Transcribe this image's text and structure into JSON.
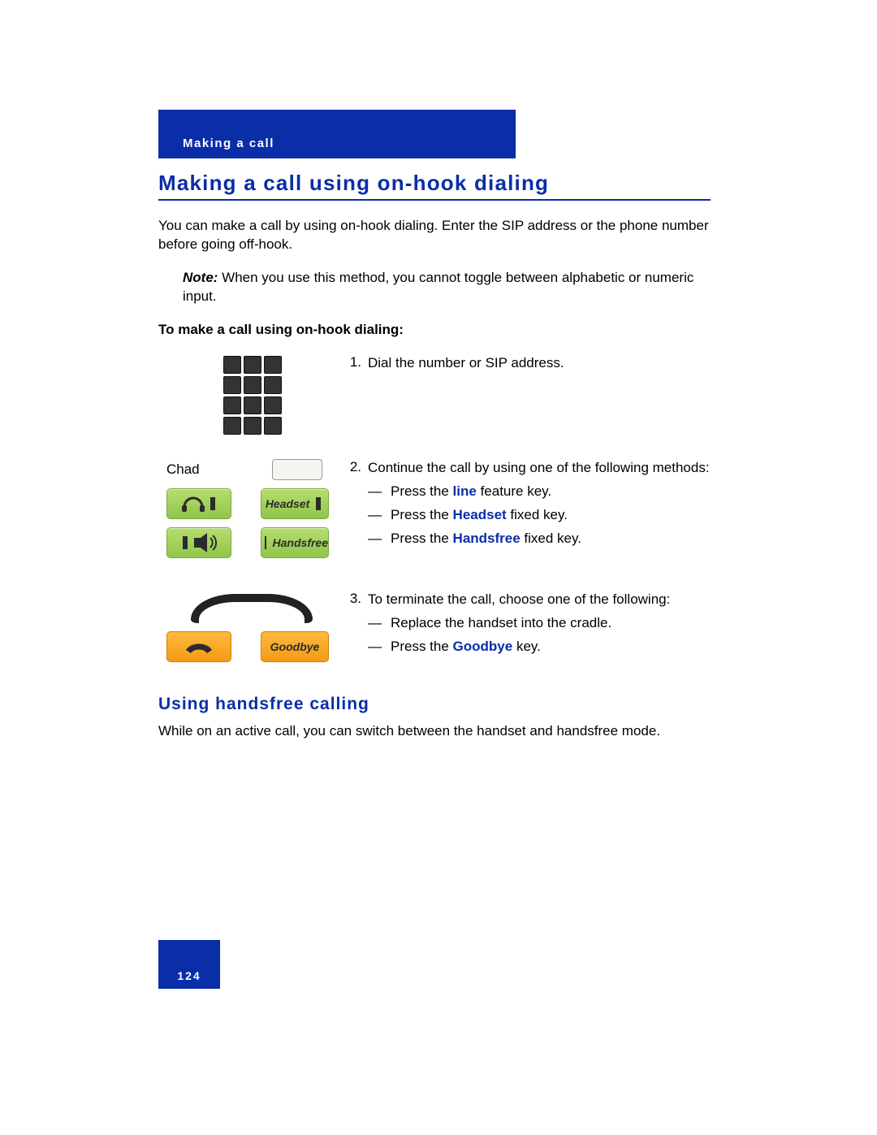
{
  "header": {
    "section": "Making a call"
  },
  "title": "Making a call using on-hook dialing",
  "intro": "You can make a call by using on-hook dialing. Enter the SIP address or the phone number before going off-hook.",
  "note": {
    "lead": "Note:",
    "text": " When you use this method, you cannot toggle between alphabetic or numeric input."
  },
  "procedure_heading": "To make a call using on-hook dialing:",
  "steps": {
    "s1": {
      "num": "1.",
      "text": "Dial the number or SIP address."
    },
    "s2": {
      "num": "2.",
      "text": "Continue the call by using one of the following methods:",
      "a_pre": "Press the ",
      "a_kw": "line",
      "a_post": " feature key.",
      "b_pre": "Press the ",
      "b_kw": "Headset",
      "b_post": " fixed key.",
      "c_pre": "Press the ",
      "c_kw": "Handsfree",
      "c_post": " fixed key."
    },
    "s3": {
      "num": "3.",
      "text": "To terminate the call, choose one of the following:",
      "a": "Replace the handset into the cradle.",
      "b_pre": "Press the ",
      "b_kw": "Goodbye",
      "b_post": " key."
    }
  },
  "icons": {
    "chad_label": "Chad",
    "headset_label": "Headset",
    "handsfree_label": "Handsfree",
    "goodbye_label": "Goodbye"
  },
  "subheading": "Using handsfree calling",
  "subtext": "While on an active call, you can switch between the handset and handsfree mode.",
  "page_number": "124",
  "dash": "—"
}
